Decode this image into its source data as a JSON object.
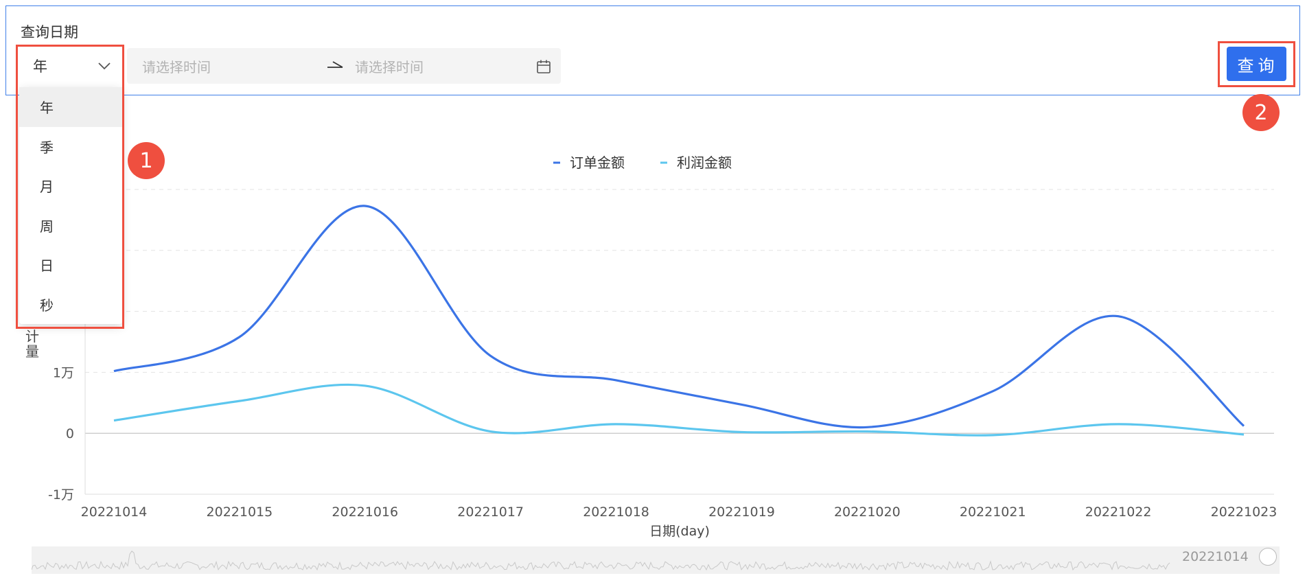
{
  "query": {
    "label": "查询日期",
    "granularity_value": "年",
    "start_placeholder": "请选择时间",
    "end_placeholder": "请选择时间",
    "button_label": "查询"
  },
  "dropdown": {
    "options": [
      "年",
      "季",
      "月",
      "周",
      "日",
      "秒"
    ],
    "highlighted_index": 0
  },
  "annotations": {
    "badge1": "1",
    "badge2": "2",
    "highlight_color": "#ef4f3f"
  },
  "colors": {
    "accent": "#2f6fed",
    "series1": "#3b74e6",
    "series2": "#5cc6ee"
  },
  "chart_data": {
    "type": "line",
    "smooth": true,
    "x": [
      "20221014",
      "20221015",
      "20221016",
      "20221017",
      "20221018",
      "20221019",
      "20221020",
      "20221021",
      "20221022",
      "20221023"
    ],
    "series": [
      {
        "name": "订单金额",
        "values": [
          10200,
          15800,
          37300,
          12700,
          8700,
          4700,
          1000,
          6900,
          19200,
          1200
        ]
      },
      {
        "name": "利润金额",
        "values": [
          2100,
          5300,
          7800,
          300,
          1500,
          200,
          300,
          -300,
          1500,
          -200
        ]
      }
    ],
    "xlabel": "日期(day)",
    "ylabel": "计量",
    "ytick_labels": [
      "1万",
      "0",
      "-1万"
    ],
    "ylim": [
      -10000,
      40000
    ],
    "grid": true,
    "legend_position": "top-center",
    "dataZoom_label": "20221014"
  }
}
